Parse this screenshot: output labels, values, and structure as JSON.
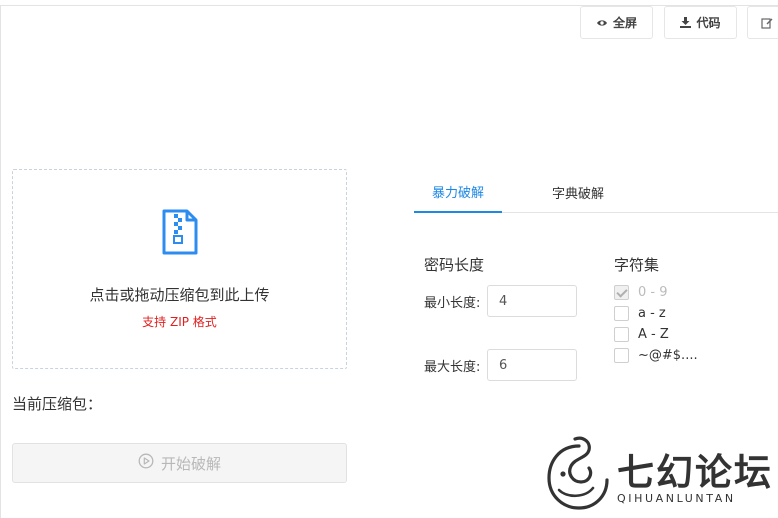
{
  "toolbar": {
    "fullscreen_label": "全屏",
    "code_label": "代码",
    "fullscreen_icon": "eye-icon",
    "code_icon": "download-icon",
    "edit_icon": "edit-icon"
  },
  "upload": {
    "icon": "zip-file-icon",
    "main_text": "点击或拖动压缩包到此上传",
    "sub_text": "支持 ZIP 格式",
    "sub_color": "#e02020"
  },
  "current_archive_label": "当前压缩包：",
  "start_button": {
    "label": "开始破解",
    "icon": "play-circle-icon",
    "disabled": true
  },
  "tabs": [
    {
      "label": "暴力破解",
      "active": true
    },
    {
      "label": "字典破解",
      "active": false
    }
  ],
  "password_length": {
    "heading": "密码长度",
    "min_label": "最小长度:",
    "min_value": "4",
    "max_label": "最大长度:",
    "max_value": "6"
  },
  "charset": {
    "heading": "字符集",
    "options": [
      {
        "label": "0 - 9",
        "checked": true,
        "disabled": true
      },
      {
        "label": "a - z",
        "checked": false,
        "disabled": false
      },
      {
        "label": "A - Z",
        "checked": false,
        "disabled": false
      },
      {
        "label": "~@#$....",
        "checked": false,
        "disabled": false
      }
    ]
  },
  "watermark": {
    "icon": "elephant-logo-icon",
    "cn_text": "七幻论坛",
    "en_text": "QIHUANLUNTAN"
  },
  "colors": {
    "accent": "#1e88e5",
    "border": "#e3e3e3"
  }
}
